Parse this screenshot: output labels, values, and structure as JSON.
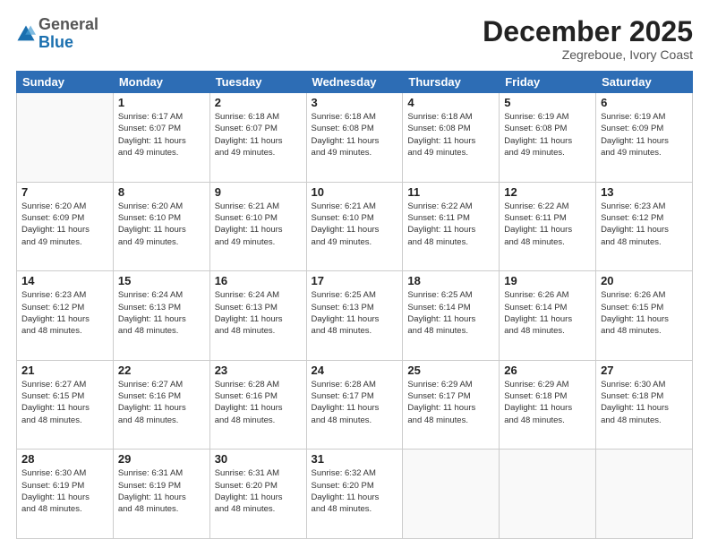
{
  "header": {
    "logo_general": "General",
    "logo_blue": "Blue",
    "month_title": "December 2025",
    "location": "Zegreboue, Ivory Coast"
  },
  "days_of_week": [
    "Sunday",
    "Monday",
    "Tuesday",
    "Wednesday",
    "Thursday",
    "Friday",
    "Saturday"
  ],
  "weeks": [
    [
      {
        "day": "",
        "info": ""
      },
      {
        "day": "1",
        "info": "Sunrise: 6:17 AM\nSunset: 6:07 PM\nDaylight: 11 hours\nand 49 minutes."
      },
      {
        "day": "2",
        "info": "Sunrise: 6:18 AM\nSunset: 6:07 PM\nDaylight: 11 hours\nand 49 minutes."
      },
      {
        "day": "3",
        "info": "Sunrise: 6:18 AM\nSunset: 6:08 PM\nDaylight: 11 hours\nand 49 minutes."
      },
      {
        "day": "4",
        "info": "Sunrise: 6:18 AM\nSunset: 6:08 PM\nDaylight: 11 hours\nand 49 minutes."
      },
      {
        "day": "5",
        "info": "Sunrise: 6:19 AM\nSunset: 6:08 PM\nDaylight: 11 hours\nand 49 minutes."
      },
      {
        "day": "6",
        "info": "Sunrise: 6:19 AM\nSunset: 6:09 PM\nDaylight: 11 hours\nand 49 minutes."
      }
    ],
    [
      {
        "day": "7",
        "info": "Sunrise: 6:20 AM\nSunset: 6:09 PM\nDaylight: 11 hours\nand 49 minutes."
      },
      {
        "day": "8",
        "info": "Sunrise: 6:20 AM\nSunset: 6:10 PM\nDaylight: 11 hours\nand 49 minutes."
      },
      {
        "day": "9",
        "info": "Sunrise: 6:21 AM\nSunset: 6:10 PM\nDaylight: 11 hours\nand 49 minutes."
      },
      {
        "day": "10",
        "info": "Sunrise: 6:21 AM\nSunset: 6:10 PM\nDaylight: 11 hours\nand 49 minutes."
      },
      {
        "day": "11",
        "info": "Sunrise: 6:22 AM\nSunset: 6:11 PM\nDaylight: 11 hours\nand 48 minutes."
      },
      {
        "day": "12",
        "info": "Sunrise: 6:22 AM\nSunset: 6:11 PM\nDaylight: 11 hours\nand 48 minutes."
      },
      {
        "day": "13",
        "info": "Sunrise: 6:23 AM\nSunset: 6:12 PM\nDaylight: 11 hours\nand 48 minutes."
      }
    ],
    [
      {
        "day": "14",
        "info": "Sunrise: 6:23 AM\nSunset: 6:12 PM\nDaylight: 11 hours\nand 48 minutes."
      },
      {
        "day": "15",
        "info": "Sunrise: 6:24 AM\nSunset: 6:13 PM\nDaylight: 11 hours\nand 48 minutes."
      },
      {
        "day": "16",
        "info": "Sunrise: 6:24 AM\nSunset: 6:13 PM\nDaylight: 11 hours\nand 48 minutes."
      },
      {
        "day": "17",
        "info": "Sunrise: 6:25 AM\nSunset: 6:13 PM\nDaylight: 11 hours\nand 48 minutes."
      },
      {
        "day": "18",
        "info": "Sunrise: 6:25 AM\nSunset: 6:14 PM\nDaylight: 11 hours\nand 48 minutes."
      },
      {
        "day": "19",
        "info": "Sunrise: 6:26 AM\nSunset: 6:14 PM\nDaylight: 11 hours\nand 48 minutes."
      },
      {
        "day": "20",
        "info": "Sunrise: 6:26 AM\nSunset: 6:15 PM\nDaylight: 11 hours\nand 48 minutes."
      }
    ],
    [
      {
        "day": "21",
        "info": "Sunrise: 6:27 AM\nSunset: 6:15 PM\nDaylight: 11 hours\nand 48 minutes."
      },
      {
        "day": "22",
        "info": "Sunrise: 6:27 AM\nSunset: 6:16 PM\nDaylight: 11 hours\nand 48 minutes."
      },
      {
        "day": "23",
        "info": "Sunrise: 6:28 AM\nSunset: 6:16 PM\nDaylight: 11 hours\nand 48 minutes."
      },
      {
        "day": "24",
        "info": "Sunrise: 6:28 AM\nSunset: 6:17 PM\nDaylight: 11 hours\nand 48 minutes."
      },
      {
        "day": "25",
        "info": "Sunrise: 6:29 AM\nSunset: 6:17 PM\nDaylight: 11 hours\nand 48 minutes."
      },
      {
        "day": "26",
        "info": "Sunrise: 6:29 AM\nSunset: 6:18 PM\nDaylight: 11 hours\nand 48 minutes."
      },
      {
        "day": "27",
        "info": "Sunrise: 6:30 AM\nSunset: 6:18 PM\nDaylight: 11 hours\nand 48 minutes."
      }
    ],
    [
      {
        "day": "28",
        "info": "Sunrise: 6:30 AM\nSunset: 6:19 PM\nDaylight: 11 hours\nand 48 minutes."
      },
      {
        "day": "29",
        "info": "Sunrise: 6:31 AM\nSunset: 6:19 PM\nDaylight: 11 hours\nand 48 minutes."
      },
      {
        "day": "30",
        "info": "Sunrise: 6:31 AM\nSunset: 6:20 PM\nDaylight: 11 hours\nand 48 minutes."
      },
      {
        "day": "31",
        "info": "Sunrise: 6:32 AM\nSunset: 6:20 PM\nDaylight: 11 hours\nand 48 minutes."
      },
      {
        "day": "",
        "info": ""
      },
      {
        "day": "",
        "info": ""
      },
      {
        "day": "",
        "info": ""
      }
    ]
  ]
}
